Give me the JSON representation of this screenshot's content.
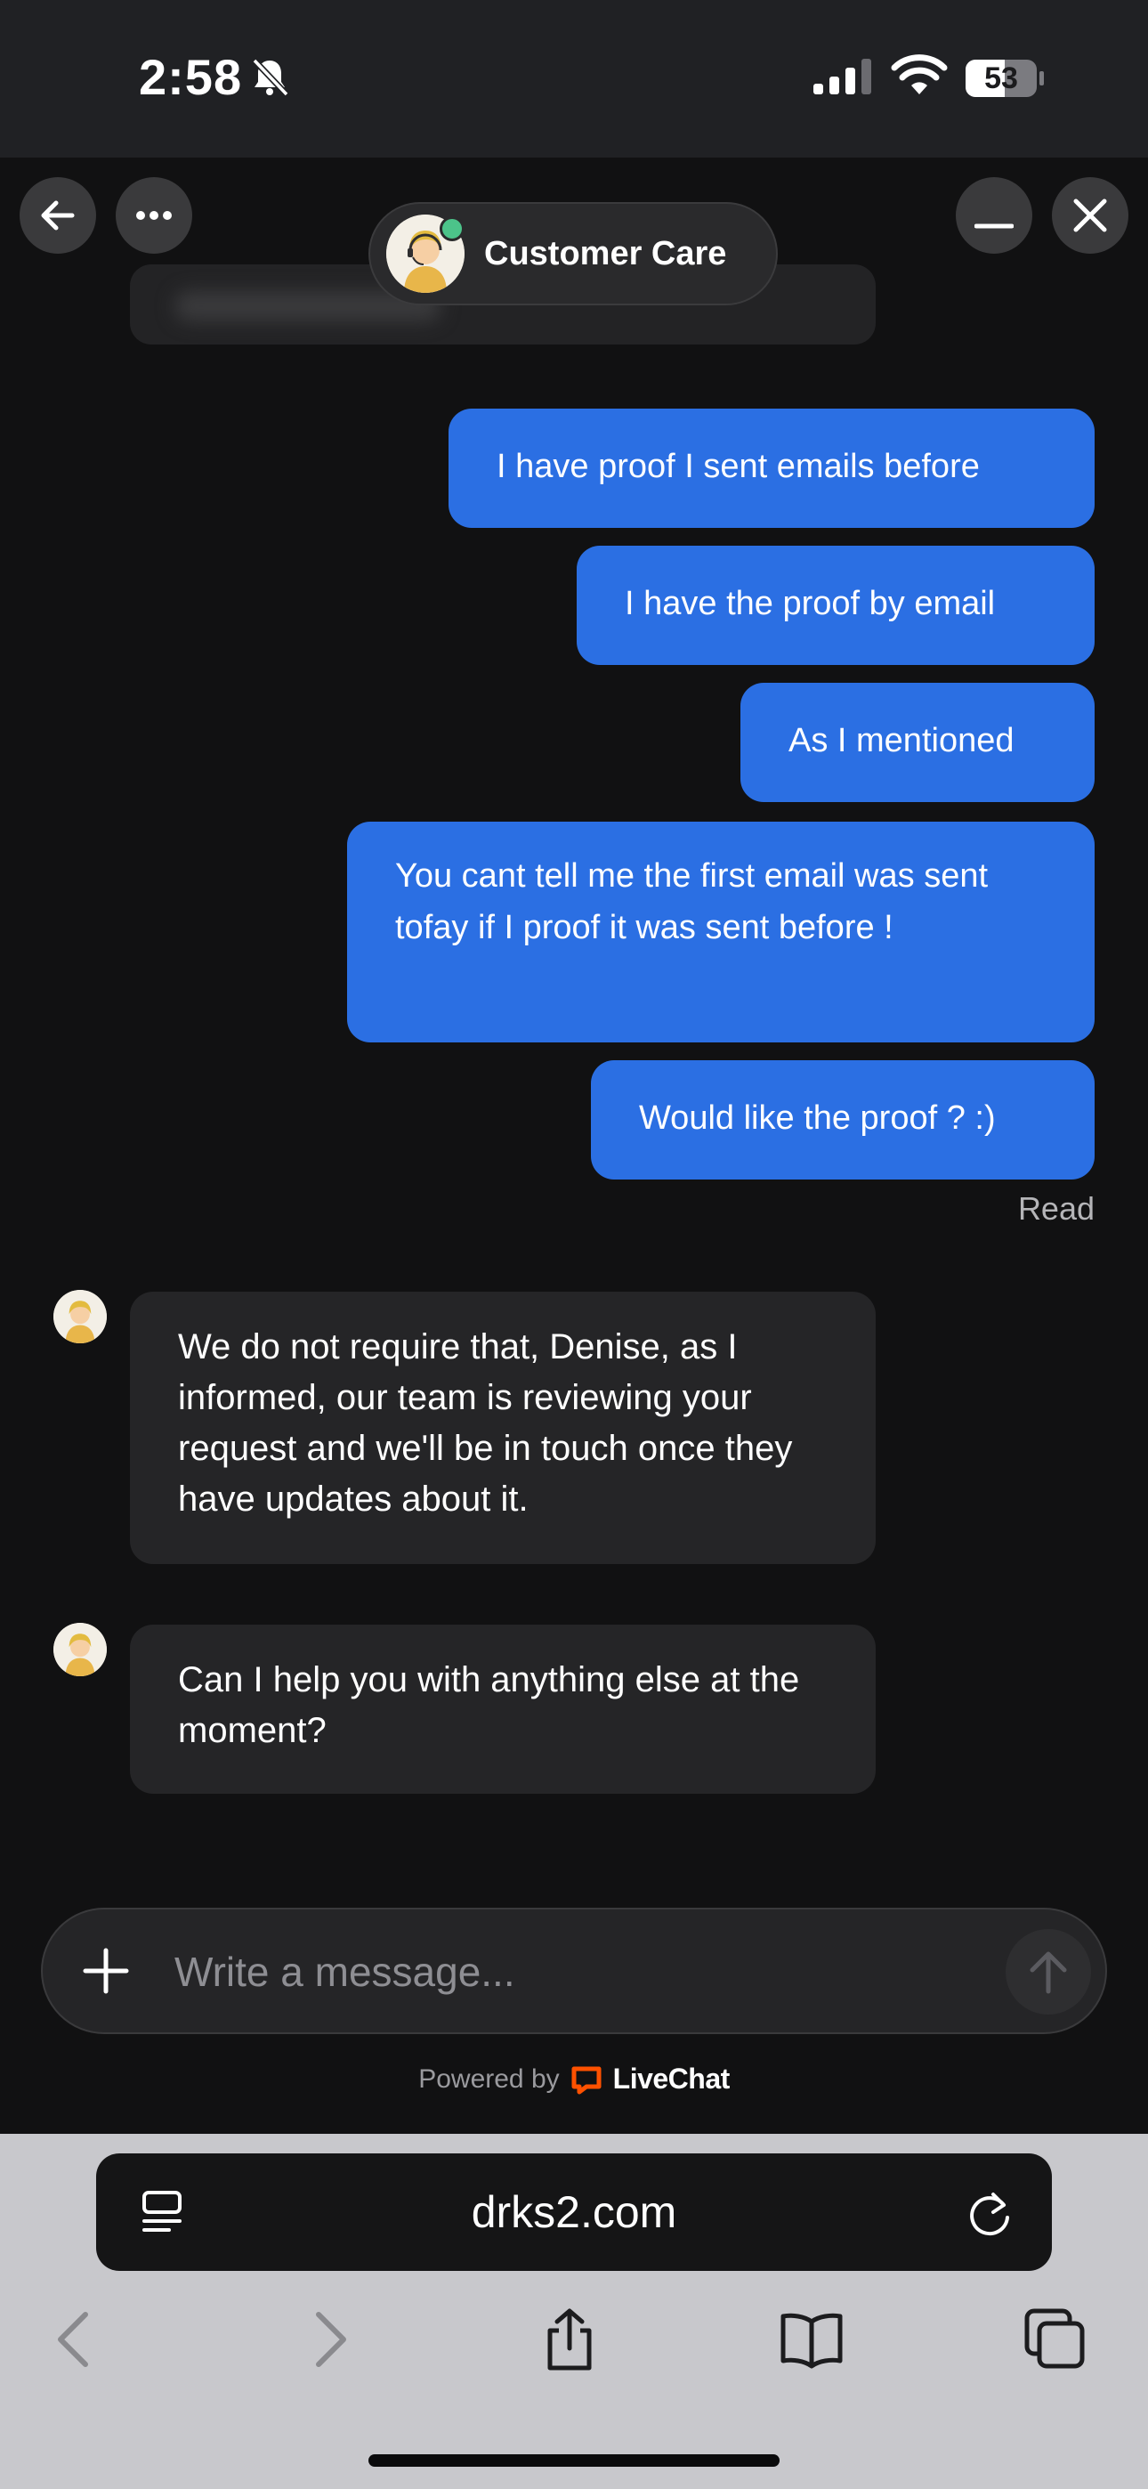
{
  "status_bar": {
    "time": "2:58",
    "battery": "53",
    "icons": [
      "bell-slash-icon",
      "cellular-signal-icon",
      "wifi-icon",
      "battery-icon"
    ]
  },
  "chat_header": {
    "agent_name": "Customer Care",
    "online_color": "#4cc38a",
    "icons": [
      "back-arrow-icon",
      "more-dots-icon",
      "minimize-icon",
      "close-icon"
    ]
  },
  "messages": {
    "outgoing": [
      "I have proof I sent emails before",
      "I have the proof by email",
      "As I mentioned",
      "You cant tell me the first email was sent tofay if I proof it was sent before !",
      "Would like the proof ? :)"
    ],
    "read_receipt": "Read",
    "incoming": [
      "We do not require that, Denise, as I informed, our team is reviewing your request and we'll be in touch once they have updates about it.",
      "Can I help you with anything else at the moment?"
    ]
  },
  "composer": {
    "placeholder": "Write a message...",
    "value": ""
  },
  "footer": {
    "powered_by": "Powered by",
    "brand": "LiveChat",
    "brand_color": "#ff5100"
  },
  "browser": {
    "url": "drks2.com",
    "toolbar": [
      "back-icon",
      "forward-icon",
      "share-icon",
      "bookmarks-icon",
      "tabs-icon"
    ]
  },
  "colors": {
    "outgoing_bubble": "#2b6fe3",
    "incoming_bubble": "#252527",
    "background": "#111112"
  }
}
